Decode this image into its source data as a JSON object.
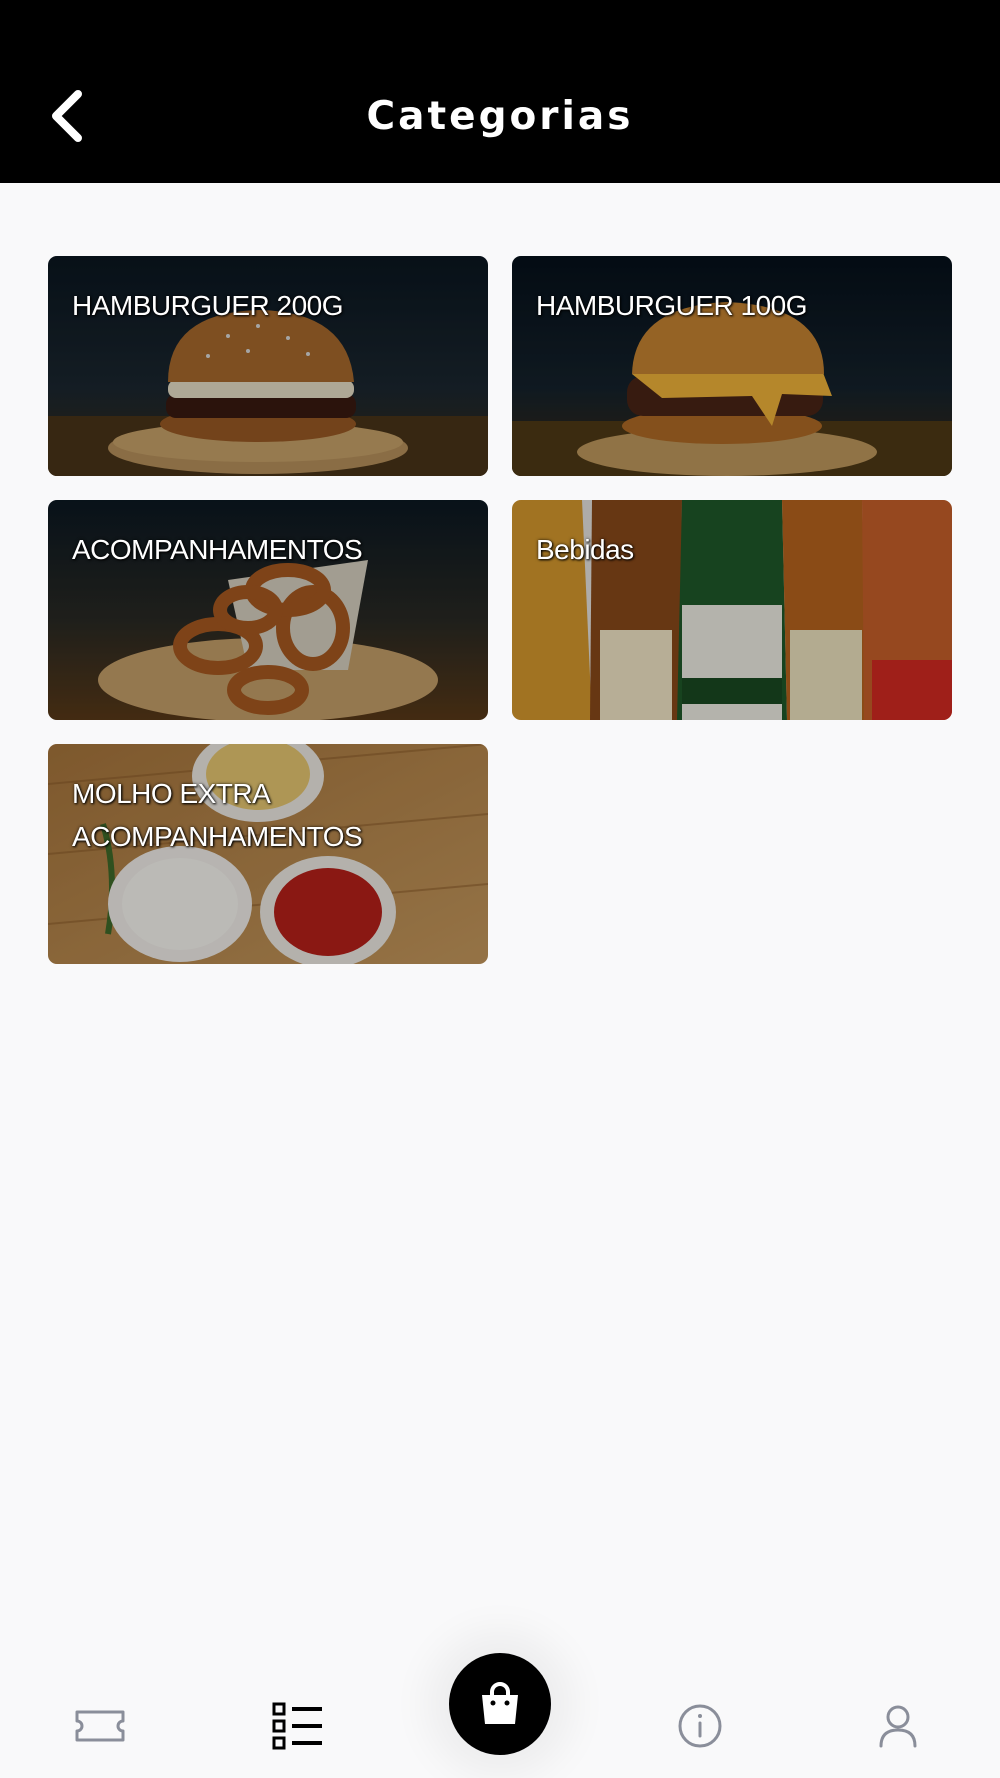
{
  "header": {
    "title": "Categorias",
    "back_icon": "chevron-left-icon"
  },
  "categories": [
    {
      "label_lines": [
        "HAMBURGUER 200G"
      ]
    },
    {
      "label_lines": [
        "HAMBURGUER 100G"
      ]
    },
    {
      "label_lines": [
        "ACOMPANHAMENTOS"
      ]
    },
    {
      "label_lines": [
        "Bebidas"
      ]
    },
    {
      "label_lines": [
        "MOLHO EXTRA",
        "ACOMPANHAMENTOS"
      ]
    }
  ],
  "bottom_nav": {
    "items": [
      {
        "icon": "ticket-icon"
      },
      {
        "icon": "list-icon",
        "active": true
      },
      {
        "icon": "shopping-bag-icon"
      },
      {
        "icon": "info-icon"
      },
      {
        "icon": "user-icon"
      }
    ]
  },
  "colors": {
    "header_bg": "#000000",
    "page_bg": "#f9f9fa",
    "nav_icon_inactive": "#8a8e9a",
    "nav_icon_active": "#000000"
  }
}
